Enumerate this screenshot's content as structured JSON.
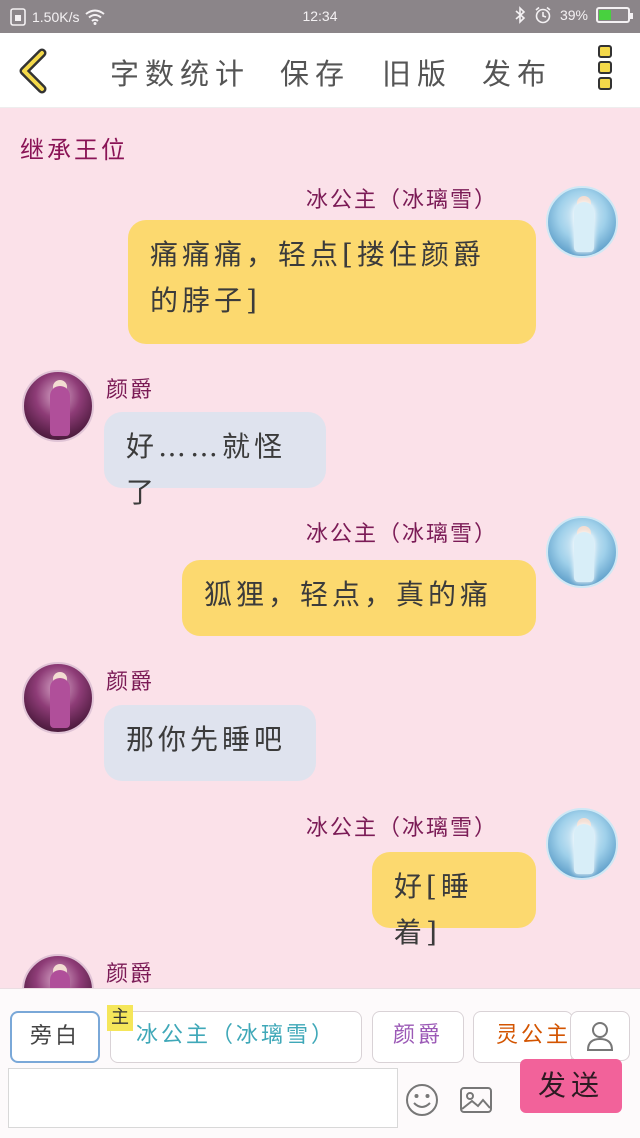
{
  "status_bar": {
    "speed": "1.50K/s",
    "time": "12:34",
    "battery_percent": "39%",
    "battery_level": 0.39
  },
  "toolbar": {
    "back_icon": "chevron-left-icon",
    "word_count_label": "字数统计",
    "save_label": "保存",
    "old_version_label": "旧版",
    "publish_label": "发布",
    "more_icon": "more-vertical-icon"
  },
  "story_title": "继承王位",
  "messages": [
    {
      "side": "right",
      "speaker": "冰公主（冰璃雪）",
      "text": "痛痛痛，轻点[搂住颜爵的脖子]"
    },
    {
      "side": "left",
      "speaker": "颜爵",
      "text": "好……就怪了"
    },
    {
      "side": "right",
      "speaker": "冰公主（冰璃雪）",
      "text": "狐狸，轻点，真的痛"
    },
    {
      "side": "left",
      "speaker": "颜爵",
      "text": "那你先睡吧"
    },
    {
      "side": "right",
      "speaker": "冰公主（冰璃雪）",
      "text": "好[睡着]"
    },
    {
      "side": "left",
      "speaker": "颜爵",
      "text": ""
    }
  ],
  "roles": {
    "narration": "旁白",
    "main_tag": "主",
    "bing": "冰公主（冰璃雪）",
    "yan": "颜爵",
    "ling": "灵公主"
  },
  "input": {
    "value": "",
    "placeholder": ""
  },
  "send_label": "发送",
  "colors": {
    "background": "#fbe1e9",
    "right_bubble": "#fcd96f",
    "left_bubble": "#dfe3ee",
    "send_button": "#f2629a",
    "name_color": "#7b1b56"
  }
}
